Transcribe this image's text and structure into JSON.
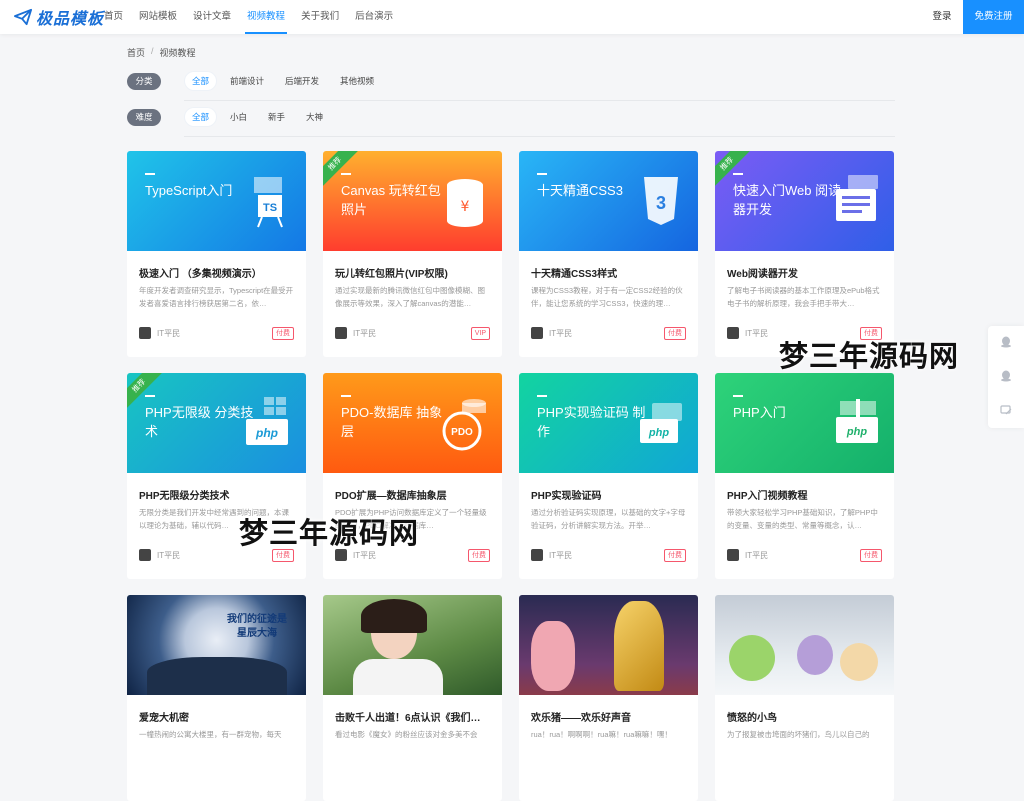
{
  "brand": {
    "name": "极品模板",
    "color": "#1a6fd6"
  },
  "nav": {
    "items": [
      "首页",
      "网站模板",
      "设计文章",
      "视频教程",
      "关于我们",
      "后台演示"
    ],
    "active": "视频教程"
  },
  "auth": {
    "login": "登录",
    "register": "免费注册"
  },
  "breadcrumb": {
    "home": "首页",
    "sep": "/",
    "current": "视频教程"
  },
  "filters": {
    "category": {
      "label": "分类",
      "options": [
        "全部",
        "前端设计",
        "后端开发",
        "其他视频"
      ],
      "active": "全部"
    },
    "difficulty": {
      "label": "难度",
      "options": [
        "全部",
        "小白",
        "新手",
        "大神"
      ],
      "active": "全部"
    }
  },
  "recommend_label": "推荐",
  "cards": [
    {
      "banner": "TypeScript入门",
      "title": "极速入门 （多集视频演示）",
      "desc": "年度开发者调查研究显示，Typescript在最受开发者喜爱语言排行榜获居第二名，依…",
      "author": "IT平民",
      "tag": "付费",
      "icon": "ts-board-icon"
    },
    {
      "banner": "Canvas 玩转红包照片",
      "title": "玩儿转红包照片(VIP权限)",
      "desc": "通过实现最新的腾讯微信红包中图像模糊、图像展示等效果，深入了解canvas的潜能…",
      "author": "IT平民",
      "tag": "VIP",
      "icon": "red-packet-icon",
      "recommend": true
    },
    {
      "banner": "十天精通CSS3",
      "title": "十天精通CSS3样式",
      "desc": "课程为CSS3教程，对于有一定CSS2经验的伙伴，能让您系统的学习CSS3，快速的理…",
      "author": "IT平民",
      "tag": "付费",
      "icon": "css3-icon"
    },
    {
      "banner": "快速入门Web 阅读器开发",
      "title": "Web阅读器开发",
      "desc": "了解电子书阅读器的基本工作原理及ePub格式电子书的解析原理，我会手把手带大…",
      "author": "IT平民",
      "tag": "付费",
      "icon": "browser-reader-icon",
      "recommend": true
    },
    {
      "banner": "PHP无限级 分类技术",
      "title": "PHP无限级分类技术",
      "desc": "无限分类是我们开发中经常遇到的问题，本课以理论为基础，辅以代码…",
      "author": "IT平民",
      "tag": "付费",
      "icon": "php-grid-icon",
      "recommend": true
    },
    {
      "banner": "PDO-数据库 抽象层",
      "title": "PDO扩展—数据库抽象层",
      "desc": "PDO扩展为PHP访问数据库定义了一个轻量级的接口，PDO解决了数据库…",
      "author": "IT平民",
      "tag": "付费",
      "icon": "pdo-database-icon"
    },
    {
      "banner": "PHP实现验证码 制作",
      "title": "PHP实现验证码",
      "desc": "通过分析验证码实现原理，以基础的文字+字母验证码，分析讲解实现方法。开举…",
      "author": "IT平民",
      "tag": "付费",
      "icon": "php-captcha-icon"
    },
    {
      "banner": "PHP入门",
      "title": "PHP入门视频教程",
      "desc": "带领大家轻松学习PHP基础知识，了解PHP中的变量、变量的类型、常量等概念，认…",
      "author": "IT平民",
      "tag": "付费",
      "icon": "php-book-icon"
    }
  ],
  "photo_cards": [
    {
      "title": "爱宠大机密",
      "desc": "一幢热闹的公寓大楼里，有一群宠物，每天",
      "overlay": "我们的征途是 星辰大海",
      "image": "moon-astronauts-photo"
    },
    {
      "title": "击败千人出道！6点认识《我们…",
      "desc": "看过电影《魔女》的粉丝应该对金多美不会",
      "image": "smiling-girl-photo"
    },
    {
      "title": "欢乐猪——欢乐好声音",
      "desc": "rua！rua！啊啊啊！rua嘛！rua嘛嘛！嘿！",
      "image": "singing-pig-photo"
    },
    {
      "title": "愤怒的小鸟",
      "desc": "为了报复被击垮面的坏猪们，鸟儿以自己的",
      "image": "angry-birds-photo"
    }
  ],
  "watermark": "梦三年源码网",
  "sidebar": {
    "icons": [
      "qq-icon",
      "qq-icon-2",
      "feedback-icon"
    ]
  }
}
